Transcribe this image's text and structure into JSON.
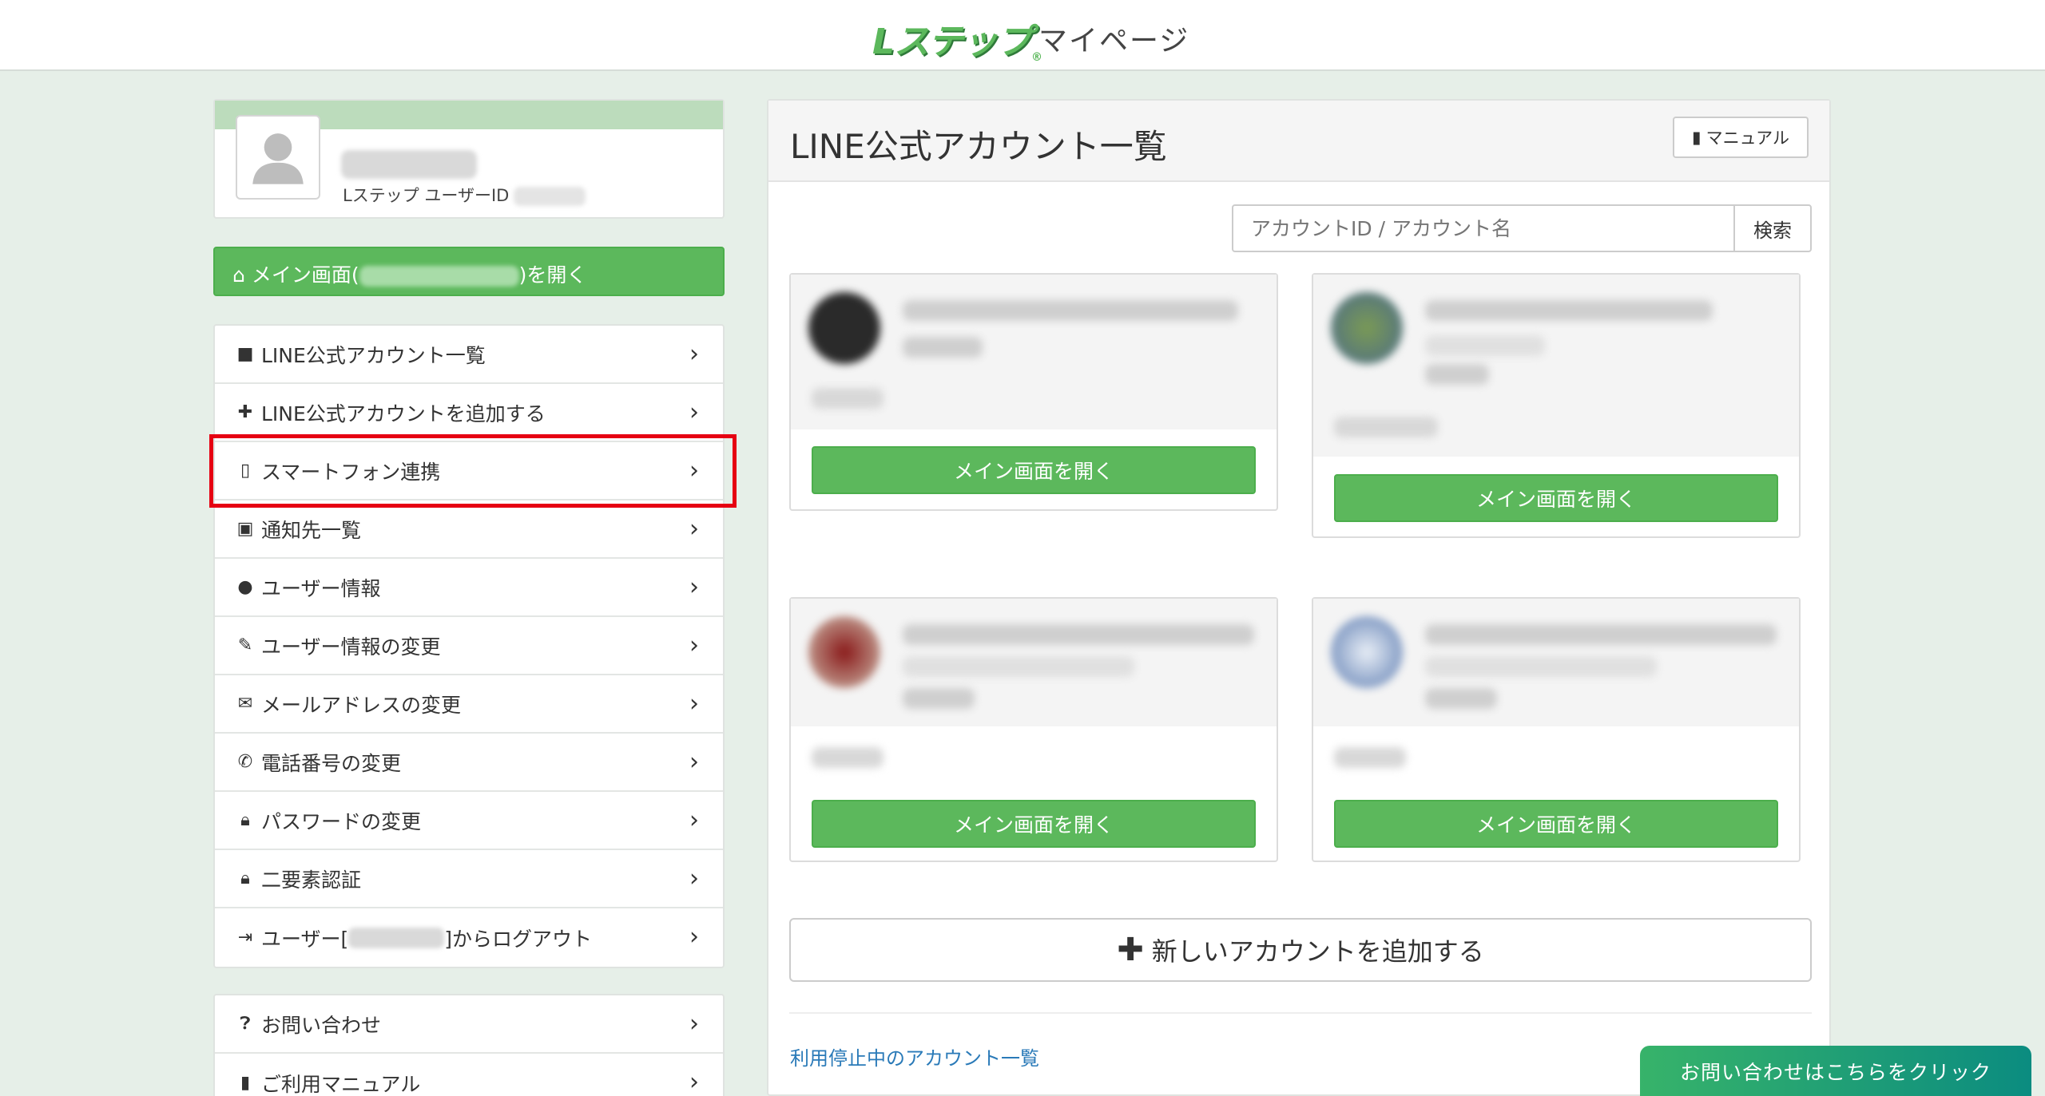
{
  "header": {
    "logo_text": "Lステップ",
    "page_title": "マイページ"
  },
  "profile": {
    "id_label": "Lステップ ユーザーID"
  },
  "sidebar": {
    "main_open_prefix": "メイン画面(",
    "main_open_suffix": ")を開く",
    "menu": [
      {
        "label": "LINE公式アカウント一覧",
        "icon": "chat-bubble-icon"
      },
      {
        "label": "LINE公式アカウントを追加する",
        "icon": "plus-icon"
      },
      {
        "label": "スマートフォン連携",
        "icon": "smartphone-icon"
      },
      {
        "label": "通知先一覧",
        "icon": "contact-card-icon"
      },
      {
        "label": "ユーザー情報",
        "icon": "user-icon"
      },
      {
        "label": "ユーザー情報の変更",
        "icon": "pencil-icon"
      },
      {
        "label": "メールアドレスの変更",
        "icon": "envelope-icon"
      },
      {
        "label": "電話番号の変更",
        "icon": "phone-icon"
      },
      {
        "label": "パスワードの変更",
        "icon": "lock-icon"
      },
      {
        "label": "二要素認証",
        "icon": "lock-icon"
      },
      {
        "label_prefix": "ユーザー[",
        "label_suffix": "]からログアウト",
        "icon": "logout-icon"
      }
    ],
    "menu2": [
      {
        "label": "お問い合わせ",
        "icon": "question-circle-icon"
      },
      {
        "label": "ご利用マニュアル",
        "icon": "book-icon"
      }
    ]
  },
  "panel": {
    "title": "LINE公式アカウント一覧",
    "manual_button": "マニュアル",
    "search_placeholder": "アカウントID / アカウント名",
    "search_button": "検索",
    "cards": [
      {
        "open_button": "メイン画面を開く"
      },
      {
        "open_button": "メイン画面を開く"
      },
      {
        "open_button": "メイン画面を開く"
      },
      {
        "open_button": "メイン画面を開く"
      }
    ],
    "add_account_button": "新しいアカウントを追加する",
    "suspended_link": "利用停止中のアカウント一覧"
  },
  "floating": {
    "contact_button": "お問い合わせはこちらをクリック"
  },
  "colors": {
    "accent_green": "#5cb85c",
    "highlight_red": "#e60012",
    "link_blue": "#2a7ab8"
  }
}
